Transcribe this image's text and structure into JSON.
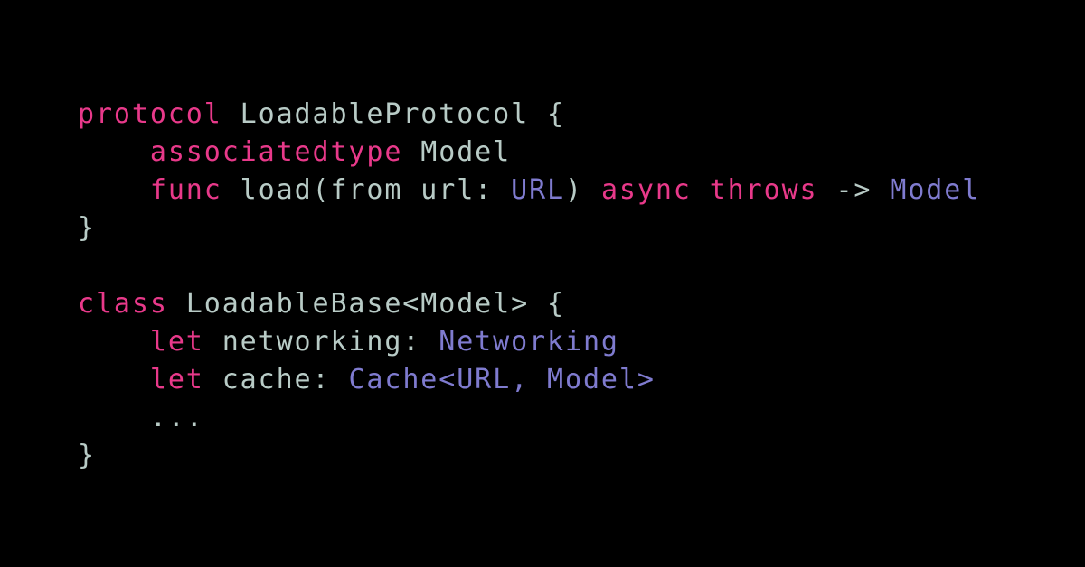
{
  "colors": {
    "background": "#000000",
    "keyword": "#e8398a",
    "type": "#7f7bcf",
    "plain": "#b8cbc6"
  },
  "code": {
    "lines": [
      [
        {
          "t": "kw",
          "v": "protocol"
        },
        {
          "t": "pl",
          "v": " LoadableProtocol {"
        }
      ],
      [
        {
          "t": "pl",
          "v": "    "
        },
        {
          "t": "kw",
          "v": "associatedtype"
        },
        {
          "t": "pl",
          "v": " Model"
        }
      ],
      [
        {
          "t": "pl",
          "v": "    "
        },
        {
          "t": "kw",
          "v": "func"
        },
        {
          "t": "pl",
          "v": " load(from url: "
        },
        {
          "t": "ty",
          "v": "URL"
        },
        {
          "t": "pl",
          "v": ") "
        },
        {
          "t": "kw",
          "v": "async"
        },
        {
          "t": "pl",
          "v": " "
        },
        {
          "t": "kw",
          "v": "throws"
        },
        {
          "t": "pl",
          "v": " -> "
        },
        {
          "t": "ty",
          "v": "Model"
        }
      ],
      [
        {
          "t": "pl",
          "v": "}"
        }
      ],
      [],
      [
        {
          "t": "kw",
          "v": "class"
        },
        {
          "t": "pl",
          "v": " LoadableBase<Model> {"
        }
      ],
      [
        {
          "t": "pl",
          "v": "    "
        },
        {
          "t": "kw",
          "v": "let"
        },
        {
          "t": "pl",
          "v": " networking: "
        },
        {
          "t": "ty",
          "v": "Networking"
        }
      ],
      [
        {
          "t": "pl",
          "v": "    "
        },
        {
          "t": "kw",
          "v": "let"
        },
        {
          "t": "pl",
          "v": " cache: "
        },
        {
          "t": "ty",
          "v": "Cache<URL, Model>"
        }
      ],
      [
        {
          "t": "pl",
          "v": "    ..."
        }
      ],
      [
        {
          "t": "pl",
          "v": "}"
        }
      ]
    ]
  }
}
